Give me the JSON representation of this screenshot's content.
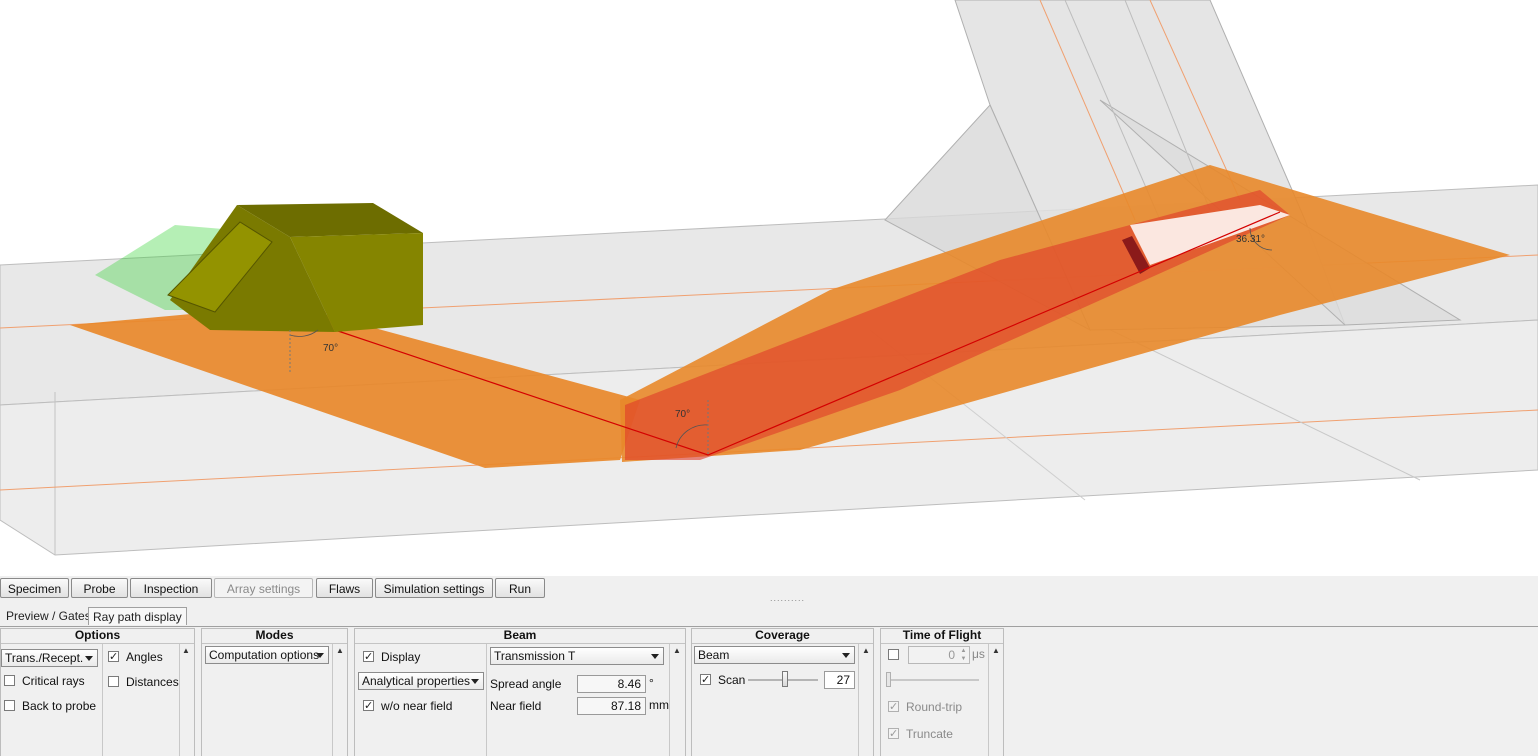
{
  "viewport": {
    "angle_labels": [
      "70°",
      "70°",
      "36.31°"
    ]
  },
  "main_tabs": [
    {
      "label": "Specimen",
      "enabled": true
    },
    {
      "label": "Probe",
      "enabled": true
    },
    {
      "label": "Inspection",
      "enabled": true
    },
    {
      "label": "Array settings",
      "enabled": false
    },
    {
      "label": "Flaws",
      "enabled": true
    },
    {
      "label": "Simulation settings",
      "enabled": true
    },
    {
      "label": "Run",
      "enabled": true
    }
  ],
  "grip": "..........",
  "sub_tabs": [
    {
      "label": "Preview / Gates",
      "active": false
    },
    {
      "label": "Ray path display",
      "active": true
    }
  ],
  "options": {
    "title": "Options",
    "mode_select": "Trans./Recept.",
    "critical_rays": {
      "label": "Critical rays",
      "checked": false
    },
    "back_to_probe": {
      "label": "Back to probe",
      "checked": false
    },
    "angles": {
      "label": "Angles",
      "checked": true
    },
    "distances": {
      "label": "Distances",
      "checked": false
    }
  },
  "modes": {
    "title": "Modes",
    "computation_select": "Computation options"
  },
  "beam": {
    "title": "Beam",
    "display": {
      "label": "Display",
      "checked": true
    },
    "properties_select": "Analytical properties",
    "wo_near_field": {
      "label": "w/o near field",
      "checked": true
    },
    "transmission_select": "Transmission T",
    "spread_angle_label": "Spread angle",
    "spread_angle_value": "8.46",
    "spread_angle_unit": "°",
    "near_field_label": "Near field",
    "near_field_value": "87.18",
    "near_field_unit": "mm"
  },
  "coverage": {
    "title": "Coverage",
    "beam_select": "Beam",
    "scan": {
      "label": "Scan",
      "checked": true
    },
    "scan_value": "27"
  },
  "time_of_flight": {
    "title": "Time of Flight",
    "enable_checked": false,
    "value": "0",
    "unit": "μs",
    "round_trip": {
      "label": "Round-trip",
      "checked": true
    },
    "truncate": {
      "label": "Truncate",
      "checked": true
    }
  },
  "colors": {
    "beam_orange": "#e8882a",
    "beam_red": "#e03a2a",
    "probe_olive": "#7a7a00",
    "wedge_green": "#2ad02a"
  }
}
